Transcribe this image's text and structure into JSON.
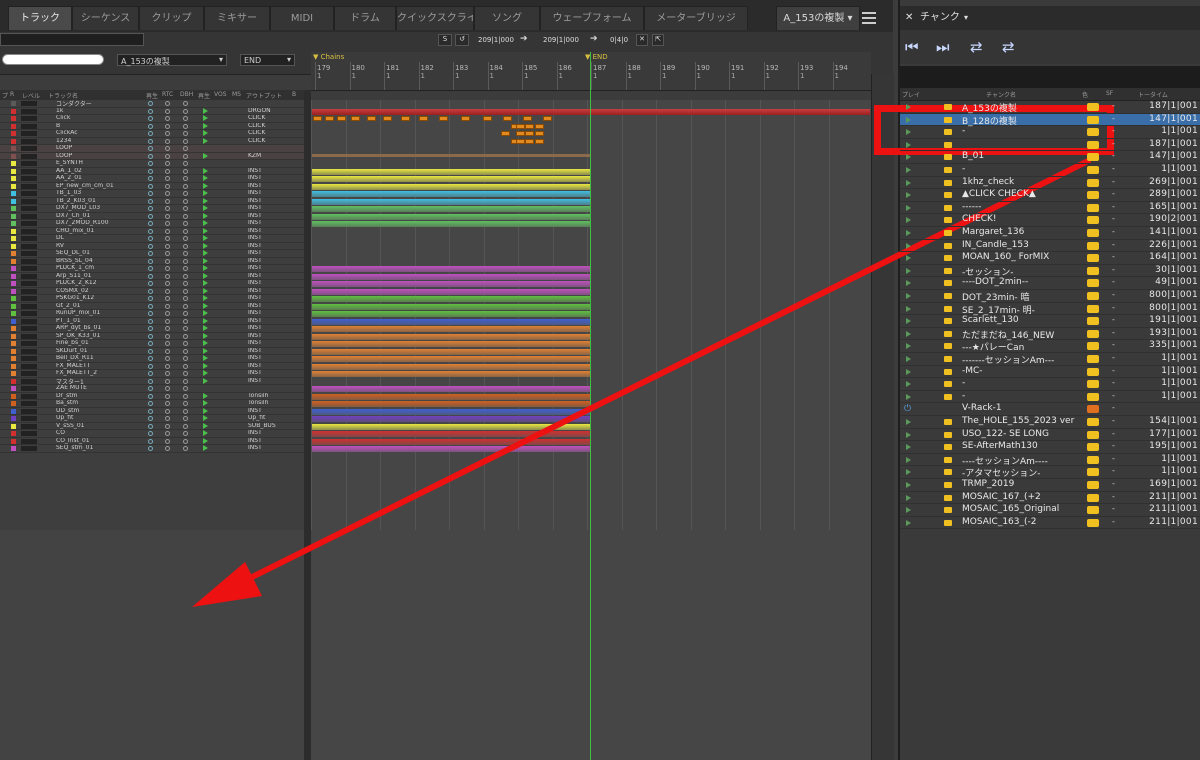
{
  "tabs": [
    {
      "label": "トラック",
      "active": true
    },
    {
      "label": "シーケンス"
    },
    {
      "label": "クリップ"
    },
    {
      "label": "ミキサー"
    },
    {
      "label": "MIDI"
    },
    {
      "label": "ドラム"
    },
    {
      "label": "クイックスクライブ"
    },
    {
      "label": "ソング"
    },
    {
      "label": "ウェーブフォーム"
    },
    {
      "label": "メーターブリッジ"
    }
  ],
  "document_tab": "A_153の複製 ▾",
  "menu_icon": "hamburger-icon",
  "toolbar": {
    "search_value": "",
    "sequence_select": "A_153の複製",
    "end_select": "END",
    "time_start": "209|1|000",
    "time_end": "209|1|000",
    "length": "0|4|0",
    "loop_label": "S"
  },
  "ruler": {
    "markers": [
      {
        "label": "Chains"
      },
      {
        "label": "END"
      }
    ],
    "bars": [
      "179",
      "180",
      "181",
      "182",
      "183",
      "184",
      "185",
      "186",
      "187",
      "188",
      "189",
      "190",
      "191",
      "192",
      "193",
      "194"
    ]
  },
  "track_header": [
    "プ",
    "R",
    "レベル",
    "トラック名",
    "再生",
    "RTC",
    "DBH",
    "再生",
    "VOS",
    "MS",
    "アウトプット",
    "B"
  ],
  "tracks": [
    {
      "name": "コンダクター",
      "out": "",
      "color": "#5a5a5a",
      "play": false
    },
    {
      "name": "1k",
      "out": "DRGON",
      "color": "#d03030",
      "play": true
    },
    {
      "name": "Click",
      "out": "CLICK",
      "color": "#d03030",
      "play": true
    },
    {
      "name": "B",
      "out": "CLICK",
      "color": "#d03030",
      "play": true
    },
    {
      "name": "ClickAc",
      "out": "CLICK",
      "color": "#d03030",
      "play": true
    },
    {
      "name": "1234",
      "out": "CLICK",
      "color": "#d03030",
      "play": true
    },
    {
      "name": "LOOP",
      "out": "",
      "color": "#805050",
      "play": false
    },
    {
      "name": "LOOP",
      "out": "KZM",
      "color": "#805050",
      "play": true
    },
    {
      "name": "E_SYNTH",
      "out": "",
      "color": "#e8e840",
      "play": false
    },
    {
      "name": "AA_1_02",
      "out": "INST",
      "color": "#e8e840",
      "play": true
    },
    {
      "name": "AA_2_01",
      "out": "INST",
      "color": "#e8e840",
      "play": true
    },
    {
      "name": "EP_new_cm_cm_01",
      "out": "INST",
      "color": "#e8e840",
      "play": true
    },
    {
      "name": "TB_1_03",
      "out": "INST",
      "color": "#40c0e0",
      "play": true
    },
    {
      "name": "TB_2_K03_01",
      "out": "INST",
      "color": "#40c0e0",
      "play": true
    },
    {
      "name": "DX7_MOD_L03",
      "out": "INST",
      "color": "#60c060",
      "play": true
    },
    {
      "name": "DX7_Ch_01",
      "out": "INST",
      "color": "#60c060",
      "play": true
    },
    {
      "name": "DX7_2MOD_R100",
      "out": "INST",
      "color": "#60c060",
      "play": true
    },
    {
      "name": "CHO_mix_01",
      "out": "INST",
      "color": "#e8e840",
      "play": true
    },
    {
      "name": "DL",
      "out": "INST",
      "color": "#e8e840",
      "play": true
    },
    {
      "name": "RV",
      "out": "INST",
      "color": "#e8e840",
      "play": true
    },
    {
      "name": "SEQ_DL_01",
      "out": "INST",
      "color": "#e08030",
      "play": true
    },
    {
      "name": "BRSS_SL_04",
      "out": "INST",
      "color": "#e08030",
      "play": true
    },
    {
      "name": "PLUCK_1_cm",
      "out": "INST",
      "color": "#c050c0",
      "play": true
    },
    {
      "name": "Arp_S11_01",
      "out": "INST",
      "color": "#c050c0",
      "play": true
    },
    {
      "name": "PLUCK_2_K12",
      "out": "INST",
      "color": "#c050c0",
      "play": true
    },
    {
      "name": "COSMX_02",
      "out": "INST",
      "color": "#c050c0",
      "play": true
    },
    {
      "name": "PSKG01_K12",
      "out": "INST",
      "color": "#60c040",
      "play": true
    },
    {
      "name": "Gt_2_01",
      "out": "INST",
      "color": "#60c040",
      "play": true
    },
    {
      "name": "RunUP_mix_01",
      "out": "INST",
      "color": "#60c040",
      "play": true
    },
    {
      "name": "PT_1_01",
      "out": "INST",
      "color": "#4060d0",
      "play": true
    },
    {
      "name": "ARP_dyt_bs_01",
      "out": "INST",
      "color": "#e08030",
      "play": true
    },
    {
      "name": "SP_OK_K33_01",
      "out": "INST",
      "color": "#e08030",
      "play": true
    },
    {
      "name": "Fine_bs_01",
      "out": "INST",
      "color": "#e08030",
      "play": true
    },
    {
      "name": "SKDurt_01",
      "out": "INST",
      "color": "#e08030",
      "play": true
    },
    {
      "name": "Bell_DX_R11",
      "out": "INST",
      "color": "#e08030",
      "play": true
    },
    {
      "name": "FX_MALETT",
      "out": "INST",
      "color": "#e08030",
      "play": true
    },
    {
      "name": "FX_MALETT_2",
      "out": "INST",
      "color": "#e08030",
      "play": true
    },
    {
      "name": "マスター1",
      "out": "INST",
      "color": "#d03030",
      "play": true
    },
    {
      "name": "ZAE MUTE",
      "out": "",
      "color": "#c050c0",
      "play": false
    },
    {
      "name": "Dr_stm",
      "out": "Tonsilh",
      "color": "#d06020",
      "play": true
    },
    {
      "name": "Ba_stm",
      "out": "Tonsilh",
      "color": "#d06020",
      "play": true
    },
    {
      "name": "UD_stm",
      "out": "INST",
      "color": "#4060d0",
      "play": true
    },
    {
      "name": "Up_fit",
      "out": "Up_fit",
      "color": "#7040c0",
      "play": true
    },
    {
      "name": "V_sSS_01",
      "out": "SUB_BUS",
      "color": "#e8e840",
      "play": true
    },
    {
      "name": "CO",
      "out": "INST",
      "color": "#d03030",
      "play": true
    },
    {
      "name": "CO_Inst_01",
      "out": "INST",
      "color": "#d03030",
      "play": true
    },
    {
      "name": "SEQ_stm_01",
      "out": "INST",
      "color": "#c050c0",
      "play": true
    }
  ],
  "panel": {
    "title": "チャンク",
    "columns": [
      "プレイ",
      "チャンク名",
      "色",
      "SF",
      "トータイム"
    ],
    "rows": [
      {
        "name": "A_153の複製",
        "time": "187|1|001",
        "selected": false
      },
      {
        "name": "B_128の複製",
        "time": "147|1|001",
        "selected": true
      },
      {
        "name": "-",
        "time": "1|1|001"
      },
      {
        "name": "",
        "time": "187|1|001"
      },
      {
        "name": "B_01",
        "time": "147|1|001"
      },
      {
        "name": "-",
        "time": "1|1|001"
      },
      {
        "name": "1khz_check",
        "time": "269|1|001"
      },
      {
        "name": "▲CLICK CHECK▲",
        "time": "289|1|001"
      },
      {
        "name": "------",
        "time": "165|1|001"
      },
      {
        "name": "CHECK!",
        "time": "190|2|001"
      },
      {
        "name": "Margaret_136",
        "time": "141|1|001"
      },
      {
        "name": "IN_Candle_153",
        "time": "226|1|001"
      },
      {
        "name": "MOAN_160_ ForMIX",
        "time": "164|1|001"
      },
      {
        "name": "-セッション-",
        "time": "30|1|001"
      },
      {
        "name": "----DOT_2min--",
        "time": "49|1|001"
      },
      {
        "name": "DOT_23min- 暗",
        "time": "800|1|001"
      },
      {
        "name": "SE_2_17min- 明-",
        "time": "800|1|001"
      },
      {
        "name": "Scarlett_130",
        "time": "191|1|001"
      },
      {
        "name": "ただまだね_146_NEW",
        "time": "193|1|001"
      },
      {
        "name": "---★パレーCan",
        "time": "335|1|001"
      },
      {
        "name": "-------セッションAm---",
        "time": "1|1|001"
      },
      {
        "name": "-MC-",
        "time": "1|1|001"
      },
      {
        "name": "-",
        "time": "1|1|001"
      },
      {
        "name": "-",
        "time": "1|1|001"
      },
      {
        "name": "V-Rack-1",
        "time": ""
      },
      {
        "name": "The_HOLE_155_2023 ver",
        "time": "154|1|001"
      },
      {
        "name": "USO_122- SE LONG",
        "time": "177|1|001"
      },
      {
        "name": "SE-AfterMath130",
        "time": "195|1|001"
      },
      {
        "name": "----セッションAm----",
        "time": "1|1|001"
      },
      {
        "name": "-アタマセッション-",
        "time": "1|1|001"
      },
      {
        "name": "TRMP_2019",
        "time": "169|1|001"
      },
      {
        "name": "MOSAIC_167_(+2",
        "time": "211|1|001"
      },
      {
        "name": "MOSAIC_165_Original",
        "time": "211|1|001"
      },
      {
        "name": "MOSAIC_163_(-2",
        "time": "211|1|001"
      }
    ]
  },
  "colors": {
    "annotation": "#ee1111",
    "selection": "#3a6ea8",
    "playhead": "#3fbf3f",
    "accent": "#f0c020"
  }
}
